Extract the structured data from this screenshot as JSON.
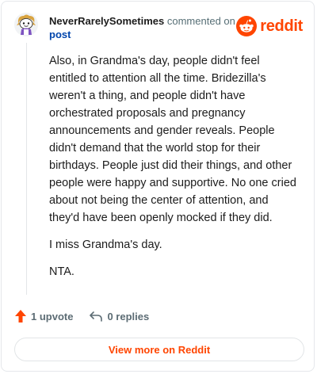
{
  "header": {
    "username": "NeverRarelySometimes",
    "action_text": "commented on",
    "post_link": "post"
  },
  "brand": {
    "name": "reddit",
    "color": "#ff4500",
    "icon": "reddit-logo-icon"
  },
  "comment": {
    "paragraphs": [
      "Also, in Grandma's day, people didn't feel entitled to attention all the time. Bridezilla's weren't a thing, and people didn't have orchestrated proposals and pregnancy announcements and gender reveals. People didn't demand that the world stop for their birthdays. People just did their things, and other people were happy and supportive. No one cried about not being the center of attention, and they'd have been openly mocked if they did.",
      "I miss Grandma's day.",
      "NTA."
    ]
  },
  "actions": {
    "upvote_label": "1 upvote",
    "upvote_icon": "upvote-arrow-icon",
    "upvote_color": "#ff4500",
    "replies_label": "0 replies",
    "replies_icon": "reply-arrow-icon"
  },
  "footer": {
    "view_more_label": "View more on Reddit"
  }
}
